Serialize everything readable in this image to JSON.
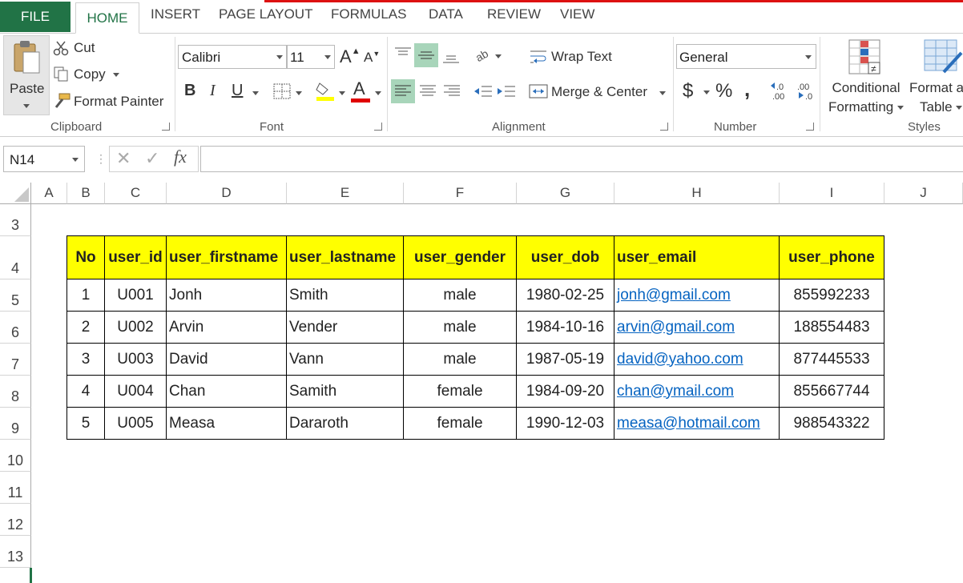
{
  "tabs": {
    "file": "FILE",
    "home": "HOME",
    "insert": "INSERT",
    "page_layout": "PAGE LAYOUT",
    "formulas": "FORMULAS",
    "data": "DATA",
    "review": "REVIEW",
    "view": "VIEW"
  },
  "clipboard": {
    "paste": "Paste",
    "cut": "Cut",
    "copy": "Copy",
    "format_painter": "Format Painter",
    "label": "Clipboard"
  },
  "font": {
    "name": "Calibri",
    "size": "11",
    "bold": "B",
    "italic": "I",
    "underline": "U",
    "label": "Font",
    "highlight_color": "#ffff00",
    "font_color": "#e00000"
  },
  "alignment": {
    "wrap_text": "Wrap Text",
    "merge_center": "Merge & Center",
    "label": "Alignment"
  },
  "number": {
    "format": "General",
    "currency": "$",
    "percent": "%",
    "comma": ",",
    "label": "Number"
  },
  "styles": {
    "conditional_1": "Conditional",
    "conditional_2": "Formatting",
    "format_as_1": "Format a",
    "format_as_2": "Table",
    "label": "Styles"
  },
  "formula_bar": {
    "name_box": "N14",
    "fx": "fx",
    "value": ""
  },
  "columns": [
    "A",
    "B",
    "C",
    "D",
    "E",
    "F",
    "G",
    "H",
    "I",
    "J"
  ],
  "rows": [
    "3",
    "4",
    "5",
    "6",
    "7",
    "8",
    "9",
    "10",
    "11",
    "12",
    "13"
  ],
  "table": {
    "headers": [
      "No",
      "user_id",
      "user_firstname",
      "user_lastname",
      "user_gender",
      "user_dob",
      "user_email",
      "user_phone"
    ],
    "rows": [
      [
        "1",
        "U001",
        "Jonh",
        "Smith",
        "male",
        "1980-02-25",
        "jonh@gmail.com",
        "855992233"
      ],
      [
        "2",
        "U002",
        "Arvin",
        "Vender",
        "male",
        "1984-10-16",
        "arvin@gmail.com",
        "188554483"
      ],
      [
        "3",
        "U003",
        "David",
        "Vann",
        "male",
        "1987-05-19",
        "david@yahoo.com",
        "877445533"
      ],
      [
        "4",
        "U004",
        "Chan",
        "Samith",
        "female",
        "1984-09-20",
        "chan@ymail.com",
        "855667744"
      ],
      [
        "5",
        "U005",
        "Measa",
        "Dararoth",
        "female",
        "1990-12-03",
        "measa@hotmail.com",
        "988543322"
      ]
    ]
  },
  "colors": {
    "excel_green": "#217346",
    "header_fill": "#ffff00",
    "link": "#0563c1"
  }
}
